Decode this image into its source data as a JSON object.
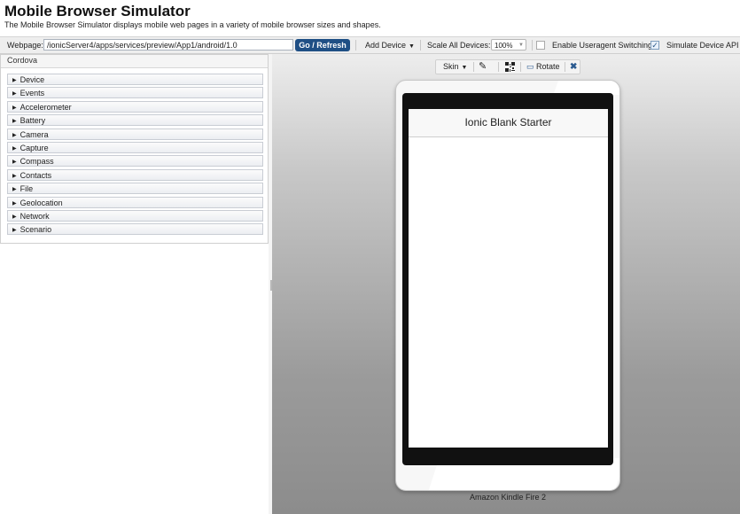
{
  "header": {
    "title": "Mobile Browser Simulator",
    "subtitle": "The Mobile Browser Simulator displays mobile web pages in a variety of mobile browser sizes and shapes."
  },
  "toolbar": {
    "webpage_label": "Webpage:",
    "url_value": "/ionicServer4/apps/services/preview/App1/android/1.0",
    "go_label": "Go / Refresh",
    "add_device_label": "Add Device",
    "scale_label": "Scale All Devices:",
    "scale_value": "100%",
    "useragent_label": "Enable Useragent Switching",
    "useragent_checked": false,
    "device_api_label": "Simulate Device API",
    "device_api_checked": true
  },
  "left_panel": {
    "header": "Cordova",
    "items": [
      {
        "label": "Device"
      },
      {
        "label": "Events"
      },
      {
        "label": "Accelerometer"
      },
      {
        "label": "Battery"
      },
      {
        "label": "Camera"
      },
      {
        "label": "Capture"
      },
      {
        "label": "Compass"
      },
      {
        "label": "Contacts"
      },
      {
        "label": "File"
      },
      {
        "label": "Geolocation"
      },
      {
        "label": "Network"
      },
      {
        "label": "Scenario"
      }
    ]
  },
  "device_toolbar": {
    "skin_label": "Skin",
    "rotate_label": "Rotate"
  },
  "device": {
    "app_title": "Ionic Blank Starter",
    "caption": "Amazon Kindle Fire 2"
  },
  "colors": {
    "go_button": "#1f4f85",
    "close_icon": "#2a5a90"
  }
}
